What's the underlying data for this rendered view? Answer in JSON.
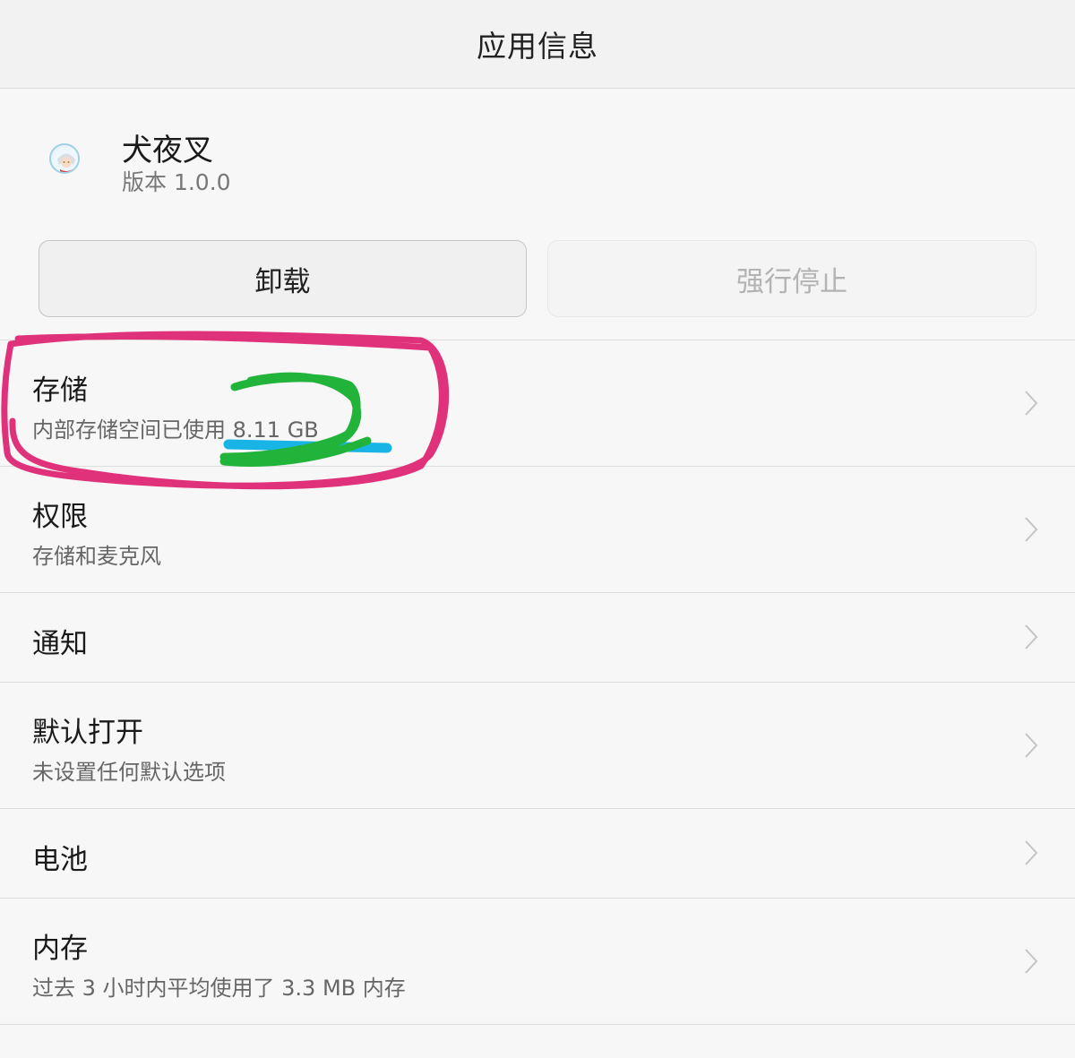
{
  "titlebar": {
    "title": "应用信息"
  },
  "app": {
    "name": "犬夜叉",
    "version": "版本 1.0.0",
    "icon": "app-avatar-icon"
  },
  "buttons": {
    "uninstall": "卸载",
    "force_stop": "强行停止"
  },
  "settings": {
    "storage": {
      "label": "存储",
      "sub": "内部存储空间已使用 8.11 GB"
    },
    "permissions": {
      "label": "权限",
      "sub": "存储和麦克风"
    },
    "notifications": {
      "label": "通知"
    },
    "default_open": {
      "label": "默认打开",
      "sub": "未设置任何默认选项"
    },
    "battery": {
      "label": "电池"
    },
    "memory": {
      "label": "内存",
      "sub": "过去 3 小时内平均使用了 3.3 MB 内存"
    }
  },
  "annotations": {
    "circle_color": "#e0327a",
    "scribble_color": "#22b33a",
    "underline_color": "#19b4e6"
  }
}
